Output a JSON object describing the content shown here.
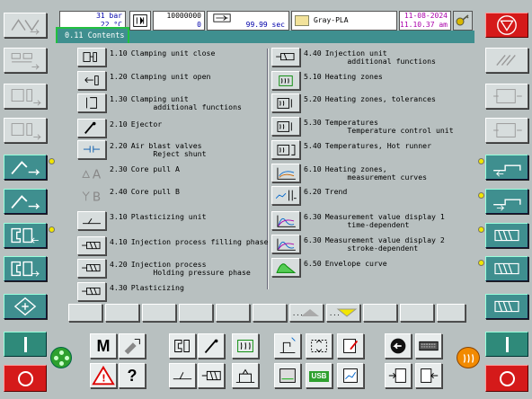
{
  "header": {
    "pressure_value": "31 bar",
    "pressure_sub": "22 °C",
    "counter_top": "10000000",
    "counter_bottom": "0",
    "cycle_time": "99.99 sec",
    "material": "Gray-PLA",
    "date": "11-08-2024",
    "time": "11.10.37 am"
  },
  "screen_tab": "0.11 Contents",
  "menu_left": [
    {
      "code": "1.10",
      "label": "Clamping unit close",
      "icon": "clamp-close-icon"
    },
    {
      "code": "1.20",
      "label": "Clamping unit open",
      "icon": "clamp-open-icon"
    },
    {
      "code": "1.30",
      "label": "Clamping unit\n     additional functions",
      "icon": "clamp-additional-icon"
    },
    {
      "code": "2.10",
      "label": "Ejector",
      "icon": "ejector-icon"
    },
    {
      "code": "2.20",
      "label": "Air blast valves\n     Reject shunt",
      "icon": "air-blast-icon"
    },
    {
      "code": "2.30",
      "label": "Core pull A",
      "icon": "core-pull-a-icon"
    },
    {
      "code": "2.40",
      "label": "Core pull B",
      "icon": "core-pull-b-icon"
    },
    {
      "code": "3.10",
      "label": "Plasticizing unit",
      "icon": "plasticizing-unit-icon"
    },
    {
      "code": "4.10",
      "label": "Injection process filling phase",
      "icon": "injection-filling-icon"
    },
    {
      "code": "4.20",
      "label": "Injection process\n     Holding pressure phase",
      "icon": "holding-pressure-icon"
    },
    {
      "code": "4.30",
      "label": "Plasticizing",
      "icon": "plasticizing-icon"
    }
  ],
  "menu_right": [
    {
      "code": "4.40",
      "label": "Injection unit\n     additional functions",
      "icon": "injection-additional-icon"
    },
    {
      "code": "5.10",
      "label": "Heating zones",
      "icon": "heating-zones-icon"
    },
    {
      "code": "5.20",
      "label": "Heating zones, tolerances",
      "icon": "heating-tolerances-icon"
    },
    {
      "code": "5.30",
      "label": "Temperatures\n     Temperature control unit",
      "icon": "temperature-control-icon"
    },
    {
      "code": "5.40",
      "label": "Temperatures, Hot runner",
      "icon": "hot-runner-icon"
    },
    {
      "code": "6.10",
      "label": "Heating zones,\n     measurement curves",
      "icon": "heating-curves-icon"
    },
    {
      "code": "6.20",
      "label": "Trend",
      "icon": "trend-icon"
    },
    {
      "code": "6.30",
      "label": "Measurement value display 1\n     time-dependent",
      "icon": "measurement-time-icon"
    },
    {
      "code": "6.30",
      "label": "Measurement value display 2\n     stroke-dependent",
      "icon": "measurement-stroke-icon"
    },
    {
      "code": "6.50",
      "label": "Envelope curve",
      "icon": "envelope-curve-icon"
    }
  ],
  "fkeys": {
    "prev_label": "...",
    "next_label": "..."
  },
  "bottom": {
    "manual_label": "M",
    "help_label": "?",
    "usb_label": "USB"
  },
  "colors": {
    "background": "#b8c0c0",
    "teal": "#3f8f8f",
    "red": "#d51a1a",
    "yellow": "#f2e600",
    "tab_border": "#22c040"
  }
}
